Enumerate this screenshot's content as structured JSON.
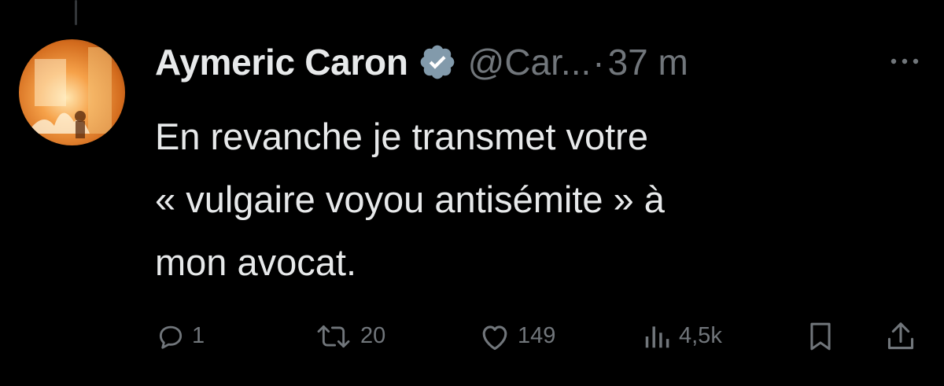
{
  "tweet": {
    "display_name": "Aymeric Caron",
    "verified_icon": "verified-badge-icon",
    "handle": "@Car...",
    "separator": "·",
    "time": "37 m",
    "more_icon": "more-dots-icon",
    "text_lines": [
      "En revanche je transmet votre",
      "« vulgaire voyou antisémite » à",
      "mon avocat."
    ]
  },
  "actions": {
    "reply": {
      "icon": "reply-icon",
      "count": "1"
    },
    "retweet": {
      "icon": "retweet-icon",
      "count": "20"
    },
    "like": {
      "icon": "heart-icon",
      "count": "149"
    },
    "views": {
      "icon": "views-chart-icon",
      "count": "4,5k"
    },
    "bookmark": {
      "icon": "bookmark-icon"
    },
    "share": {
      "icon": "share-icon"
    }
  },
  "colors": {
    "background": "#000000",
    "text_primary": "#e7e9ea",
    "text_secondary": "#71767b",
    "thread_line": "#333639"
  }
}
